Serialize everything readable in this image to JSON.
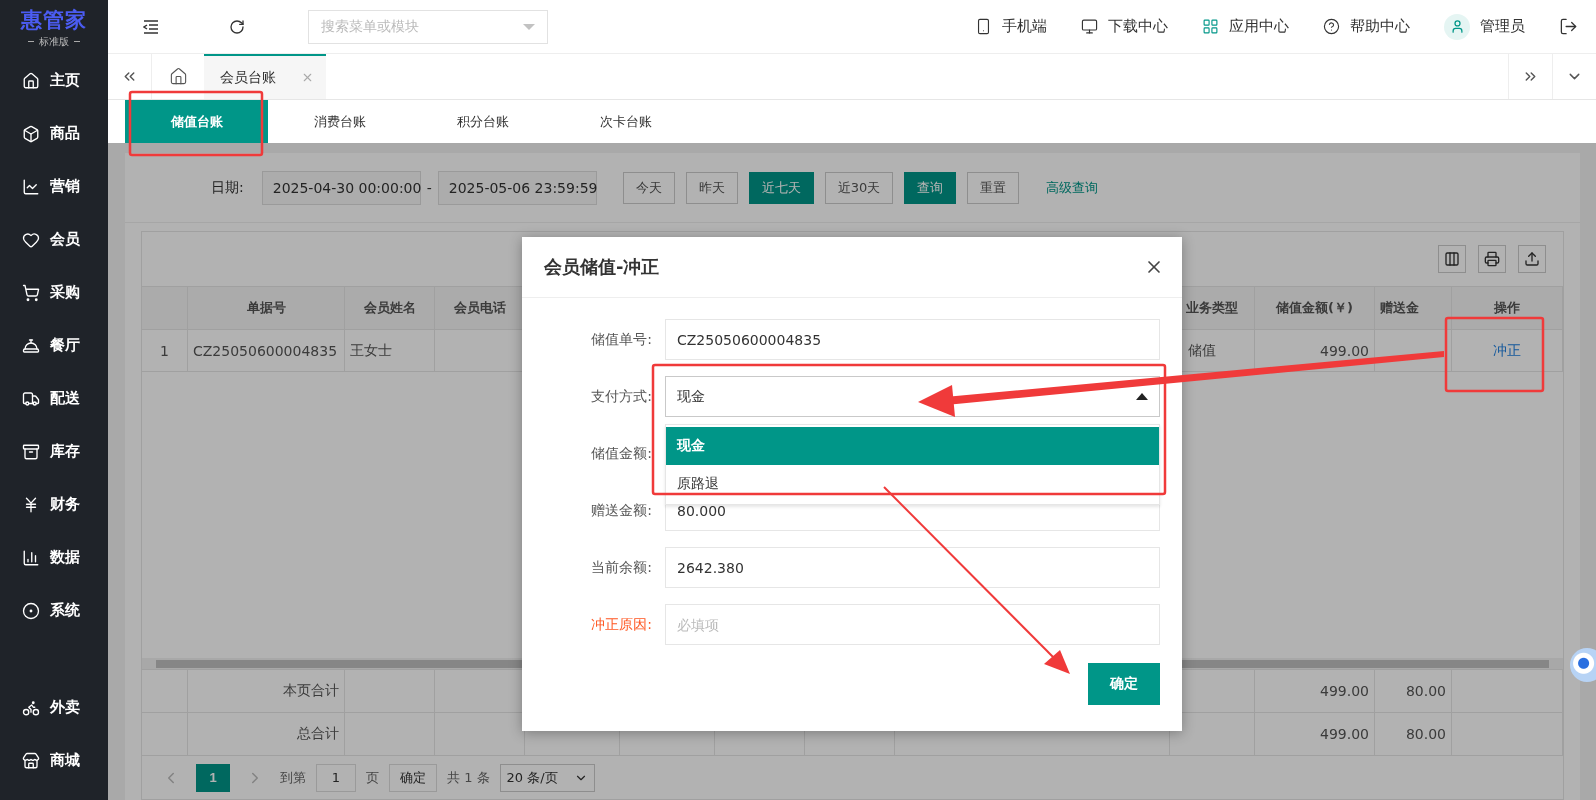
{
  "logo": {
    "title": "惠管家",
    "subtitle": "标准版"
  },
  "sidebar": {
    "items": [
      {
        "label": "主页"
      },
      {
        "label": "商品"
      },
      {
        "label": "营销"
      },
      {
        "label": "会员"
      },
      {
        "label": "采购"
      },
      {
        "label": "餐厅"
      },
      {
        "label": "配送"
      },
      {
        "label": "库存"
      },
      {
        "label": "财务"
      },
      {
        "label": "数据"
      },
      {
        "label": "系统"
      }
    ],
    "bottom_items": [
      {
        "label": "外卖"
      },
      {
        "label": "商城"
      }
    ]
  },
  "topbar": {
    "search": {
      "placeholder": "搜索菜单或模块"
    },
    "links": [
      "手机端",
      "下载中心",
      "应用中心",
      "帮助中心"
    ],
    "user": "管理员"
  },
  "page_tabs": [
    {
      "label": "会员台账",
      "selected": true
    }
  ],
  "sub_tabs": [
    {
      "label": "储值台账",
      "selected": true
    },
    {
      "label": "消费台账",
      "selected": false
    },
    {
      "label": "积分台账",
      "selected": false
    },
    {
      "label": "次卡台账",
      "selected": false
    }
  ],
  "filter": {
    "label": "日期:",
    "start": "2025-04-30 00:00:00",
    "separator": "-",
    "end": "2025-05-06 23:59:59",
    "ranges": [
      {
        "label": "今天",
        "selected": false
      },
      {
        "label": "昨天",
        "selected": false
      },
      {
        "label": "近七天",
        "selected": true
      },
      {
        "label": "近30天",
        "selected": false
      }
    ],
    "actions": [
      {
        "label": "查询",
        "kind": "primary"
      },
      {
        "label": "重置",
        "kind": "default"
      }
    ],
    "advanced_link": "高级查询"
  },
  "table": {
    "left_columns": [
      "单据号",
      "会员姓名",
      "会员电话"
    ],
    "right_columns": [
      "业务类型",
      "储值金额(￥)",
      "赠送金",
      "操作"
    ],
    "rows": [
      {
        "index": "1",
        "order_no": "CZ25050600004835",
        "member_name": "王女士",
        "business_type": "储值",
        "amount": "499.00",
        "action": "冲正"
      }
    ],
    "summary": [
      {
        "label": "本页合计",
        "amount": "499.00",
        "bonus": "80.00"
      },
      {
        "label": "总合计",
        "amount": "499.00",
        "bonus": "80.00"
      }
    ]
  },
  "pagination": {
    "pages": [
      {
        "label": "1",
        "selected": true
      }
    ],
    "goto_label": "到第",
    "goto_value": "1",
    "page_unit": "页",
    "confirm": "确定",
    "total": "共 1 条",
    "page_size": "20 条/页"
  },
  "dialog": {
    "title": "会员储值-冲正",
    "fields": [
      {
        "label": "储值单号:",
        "kind": "text",
        "value": "CZ25050600004835"
      },
      {
        "label": "支付方式:",
        "kind": "select",
        "value": "现金",
        "expanded": true,
        "options": [
          {
            "label": "现金",
            "selected": true
          },
          {
            "label": "原路退",
            "selected": false
          }
        ]
      },
      {
        "label": "储值金额:",
        "kind": "text"
      },
      {
        "label": "赠送金额:",
        "kind": "text",
        "value": "80.000"
      },
      {
        "label": "当前余额:",
        "kind": "text",
        "value": "2642.380"
      },
      {
        "label": "冲正原因:",
        "kind": "text",
        "placeholder": "必填项",
        "required": true
      }
    ],
    "confirm": "确定"
  }
}
